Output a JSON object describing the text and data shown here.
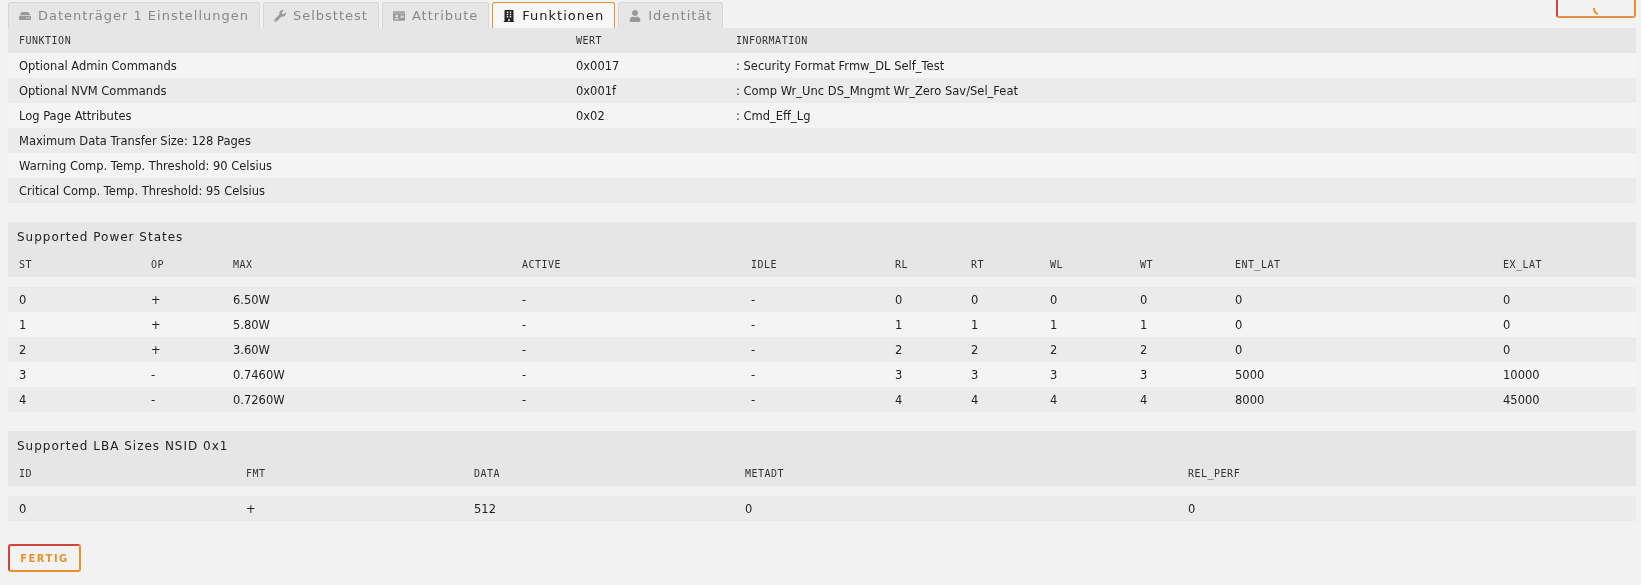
{
  "tabs": [
    {
      "label": "Datenträger 1 Einstellungen",
      "selected": false
    },
    {
      "label": "Selbsttest",
      "selected": false
    },
    {
      "label": "Attribute",
      "selected": false
    },
    {
      "label": "Funktionen",
      "selected": true
    },
    {
      "label": "Identität",
      "selected": false
    }
  ],
  "functions": {
    "columns": [
      "FUNKTION",
      "WERT",
      "INFORMATION"
    ],
    "rows": [
      {
        "kind": "triple",
        "cells": [
          "Optional Admin Commands",
          "0x0017",
          ": Security Format Frmw_DL Self_Test"
        ]
      },
      {
        "kind": "triple",
        "cells": [
          "Optional NVM Commands",
          "0x001f",
          ": Comp Wr_Unc DS_Mngmt Wr_Zero Sav/Sel_Feat"
        ]
      },
      {
        "kind": "triple",
        "cells": [
          "Log Page Attributes",
          "0x02",
          ": Cmd_Eff_Lg"
        ]
      },
      {
        "kind": "single",
        "cells": [
          "Maximum Data Transfer Size: 128 Pages"
        ]
      },
      {
        "kind": "single",
        "cells": [
          "Warning Comp. Temp. Threshold: 90 Celsius"
        ]
      },
      {
        "kind": "single",
        "cells": [
          "Critical Comp. Temp. Threshold: 95 Celsius"
        ]
      }
    ]
  },
  "power_states": {
    "title": "Supported Power States",
    "columns": [
      "ST",
      "OP",
      "MAX",
      "ACTIVE",
      "IDLE",
      "RL",
      "RT",
      "WL",
      "WT",
      "ENT_LAT",
      "EX_LAT"
    ],
    "rows": [
      [
        "0",
        "+",
        "6.50W",
        "-",
        "-",
        "0",
        "0",
        "0",
        "0",
        "0",
        "0"
      ],
      [
        "1",
        "+",
        "5.80W",
        "-",
        "-",
        "1",
        "1",
        "1",
        "1",
        "0",
        "0"
      ],
      [
        "2",
        "+",
        "3.60W",
        "-",
        "-",
        "2",
        "2",
        "2",
        "2",
        "0",
        "0"
      ],
      [
        "3",
        "-",
        "0.7460W",
        "-",
        "-",
        "3",
        "3",
        "3",
        "3",
        "5000",
        "10000"
      ],
      [
        "4",
        "-",
        "0.7260W",
        "-",
        "-",
        "4",
        "4",
        "4",
        "4",
        "8000",
        "45000"
      ]
    ]
  },
  "lba_sizes": {
    "title": "Supported LBA Sizes NSID 0x1",
    "columns": [
      "ID",
      "FMT",
      "DATA",
      "METADT",
      "REL_PERF"
    ],
    "rows": [
      [
        "0",
        "+",
        "512",
        "0",
        "0"
      ]
    ]
  },
  "buttons": [
    "FERTIG"
  ]
}
